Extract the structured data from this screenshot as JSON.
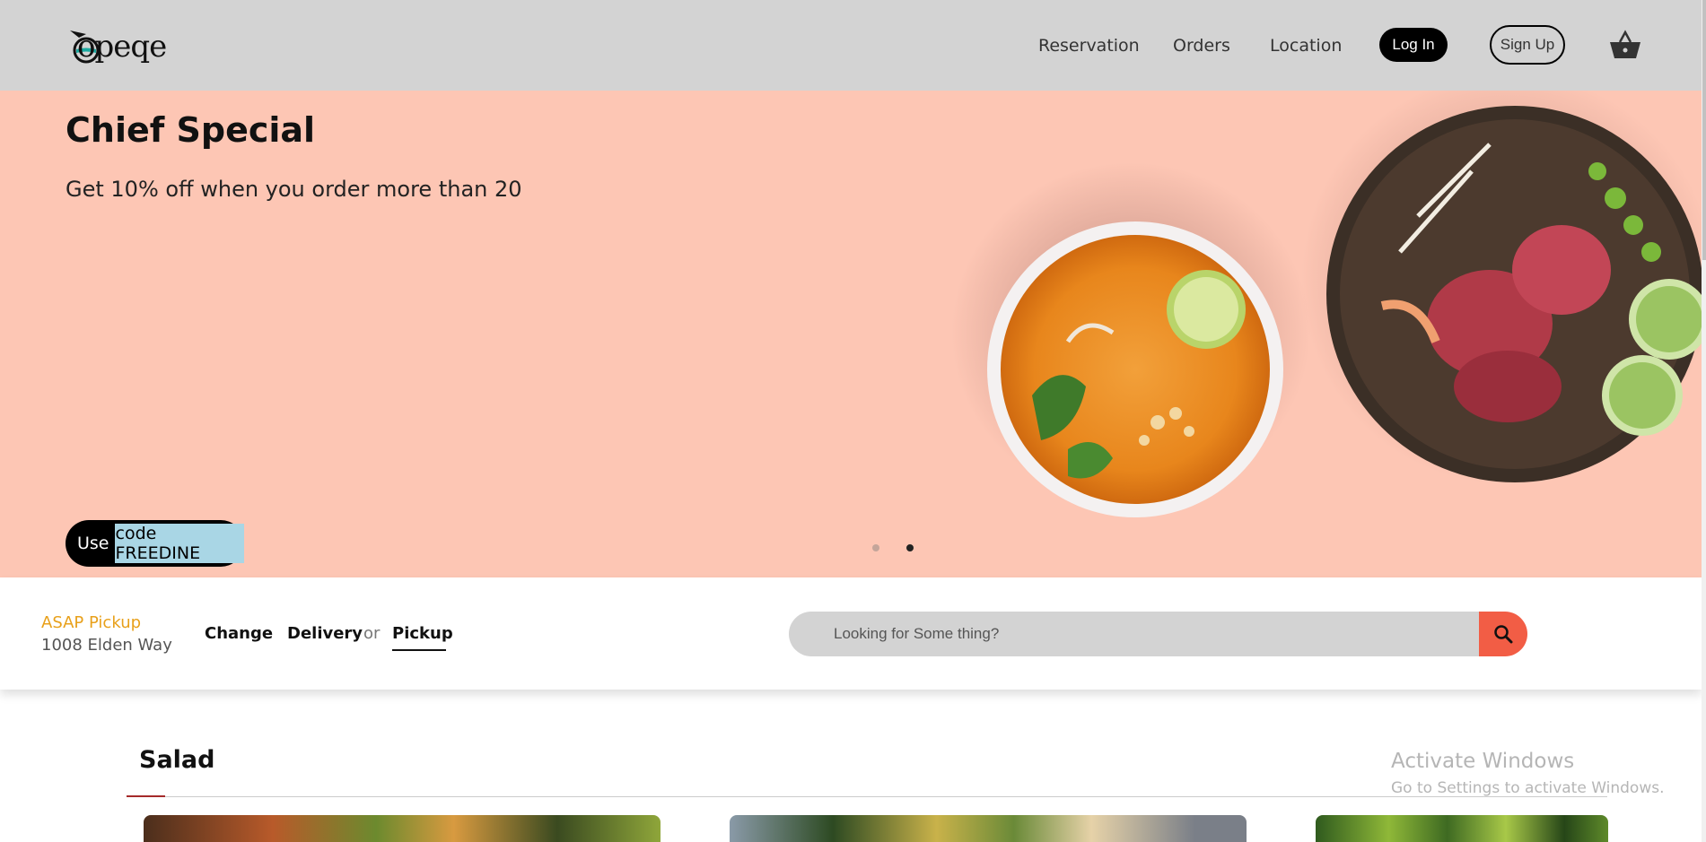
{
  "header": {
    "logo_text": "opeqe",
    "nav": [
      "Reservation",
      "Orders",
      "Location"
    ],
    "login_label": "Log In",
    "signup_label": "Sign Up",
    "cart_icon": "basket-icon"
  },
  "hero": {
    "title": "Chief Special",
    "subtitle": "Get 10% off when you order more than 20",
    "promo_prefix": "Use",
    "promo_code": "code FREEDINE",
    "carousel_active_index": 2,
    "colors": {
      "background": "#fdc6b4",
      "promo_highlight": "#a9d6e5"
    }
  },
  "order_bar": {
    "pickup_label": "ASAP Pickup",
    "address": "1008 Elden Way",
    "change_label": "Change",
    "delivery_label": "Delivery",
    "or_label": "or",
    "pickup_option_label": "Pickup",
    "selected_option": "Pickup",
    "search_placeholder": "Looking for Some thing?",
    "search_icon": "search-icon",
    "colors": {
      "pickup_label": "#e8a01a",
      "search_button": "#f25d45"
    }
  },
  "section": {
    "title": "Salad",
    "accent_color": "#a52a2a"
  },
  "watermark": {
    "title": "Activate Windows",
    "subtitle": "Go to Settings to activate Windows."
  }
}
